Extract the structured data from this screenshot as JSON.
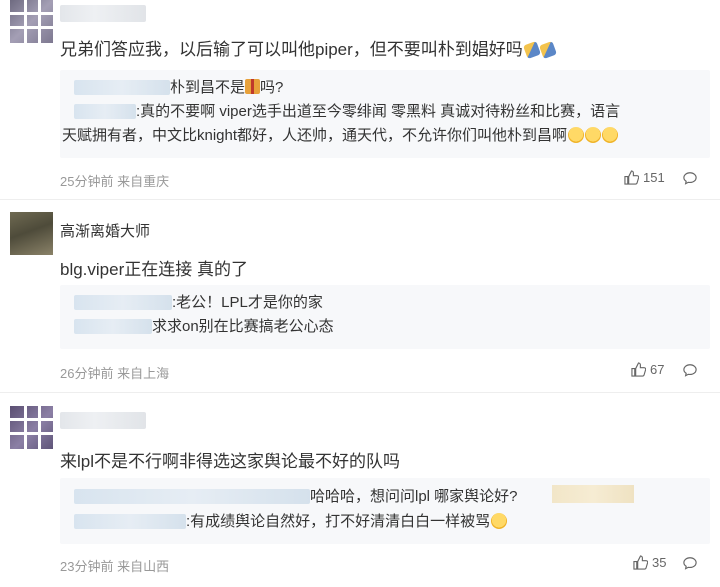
{
  "comments": [
    {
      "username": "",
      "text": "兄弟们答应我，以后输了可以叫他piper，但不要叫朴到娼好吗",
      "replies": [
        {
          "text": "朴到昌不是",
          "tail": "吗?"
        },
        {
          "text": ":真的不要啊 viper选手出道至今零绯闻 零黑料 真诚对待粉丝和比赛，语言"
        },
        {
          "text": "天赋拥有者，中文比knight都好，人还帅，通天代，不允许你们叫他朴到昌啊"
        }
      ],
      "time": "25分钟前 来自重庆",
      "likes": "151"
    },
    {
      "username": "高渐离婚大师",
      "text": "blg.viper正在连接 真的了",
      "replies": [
        {
          "text": ":老公！LPL才是你的家"
        },
        {
          "text": "求求on别在比赛搞老公心态"
        }
      ],
      "time": "26分钟前 来自上海",
      "likes": "67"
    },
    {
      "username": "",
      "text": "来lpl不是不行啊非得选这家舆论最不好的队吗",
      "replies": [
        {
          "text": "哈哈哈，想问问lpl 哪家舆论好?"
        },
        {
          "text": ":有成绩舆论自然好，打不好清清白白一样被骂"
        }
      ],
      "time": "23分钟前 来自山西",
      "likes": "35"
    }
  ],
  "icons": {
    "like": "thumbs-up-icon",
    "reply": "comment-bubble-icon"
  },
  "colors": {
    "meta": "#999999",
    "reply_bg": "#f7f8fa",
    "divider": "#eeeeee"
  }
}
